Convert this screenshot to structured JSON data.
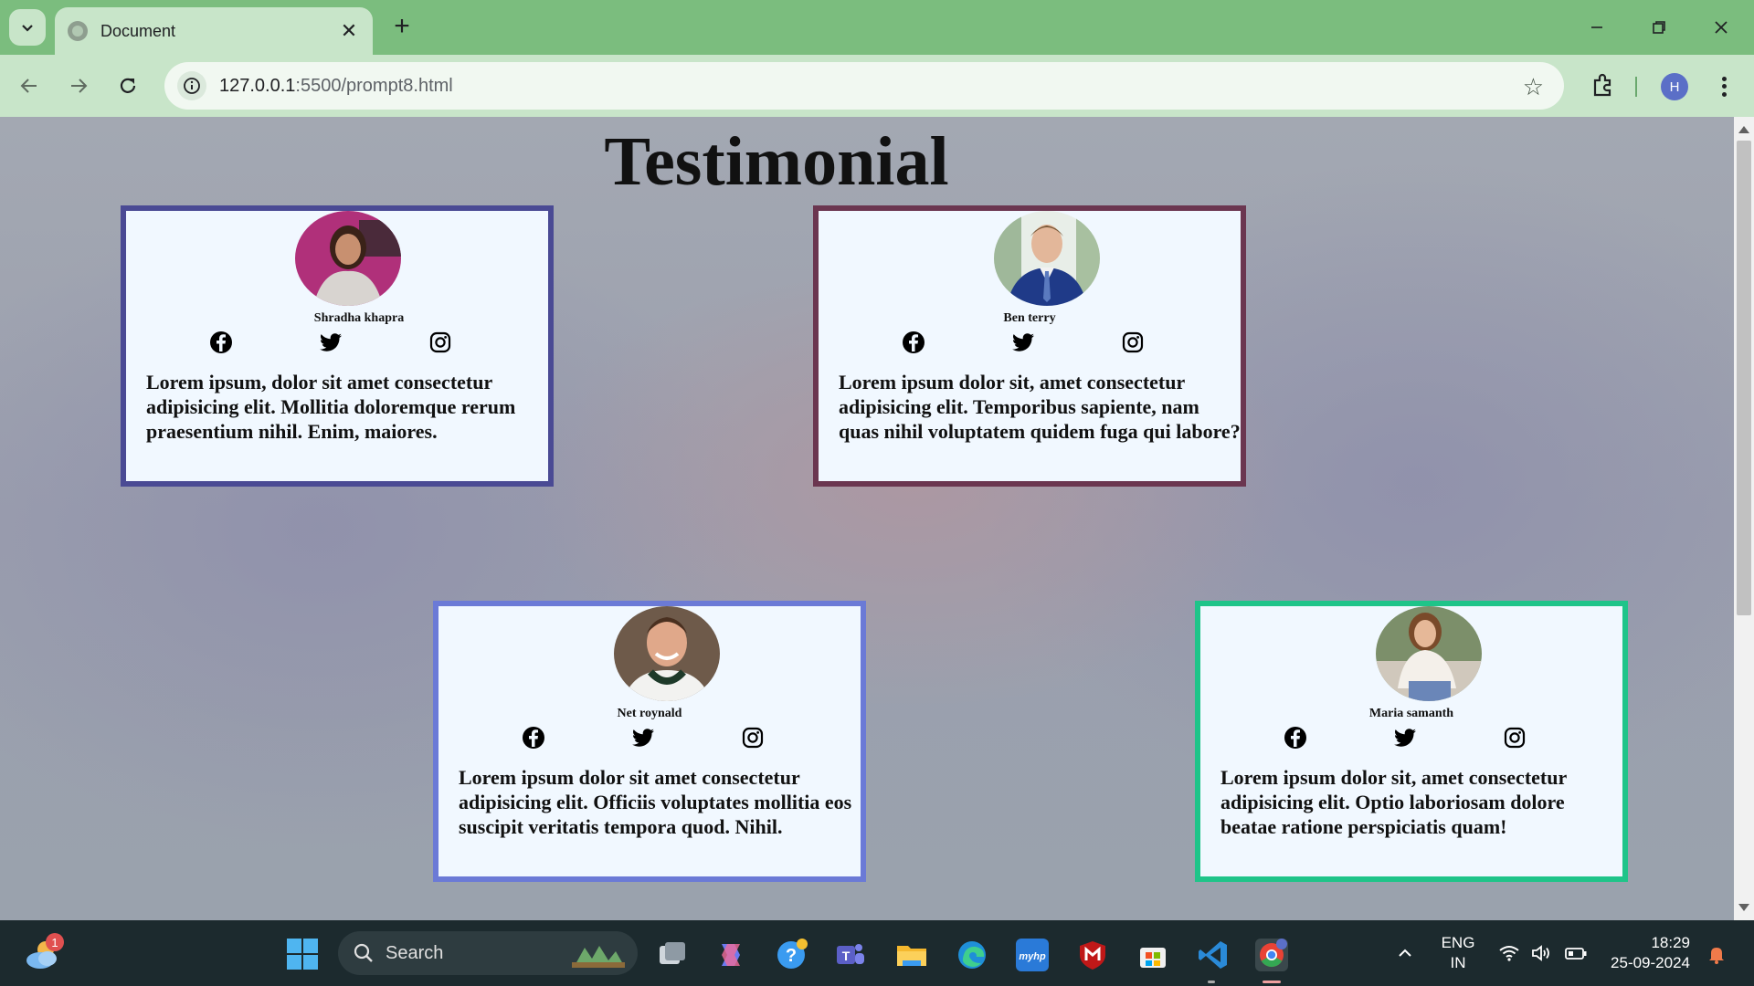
{
  "browser": {
    "tab_title": "Document",
    "url_host": "127.0.0.1",
    "url_path": ":5500/prompt8.html",
    "profile_initial": "H"
  },
  "page": {
    "title": "Testimonial",
    "cards": [
      {
        "name": "Shradha khapra",
        "quote": "Lorem ipsum, dolor sit amet consectetur adipisicing elit. Mollitia doloremque rerum praesentium nihil. Enim, maiores.",
        "border_color": "#4a4a94"
      },
      {
        "name": "Ben terry",
        "quote": "Lorem ipsum dolor sit, amet consectetur adipisicing elit. Temporibus sapiente, nam quas nihil voluptatem quidem fuga qui labore?",
        "border_color": "#6b3650"
      },
      {
        "name": "Net roynald",
        "quote": "Lorem ipsum dolor sit amet consectetur adipisicing elit. Officiis voluptates mollitia eos suscipit veritatis tempora quod. Nihil.",
        "border_color": "#6b7ad6"
      },
      {
        "name": "Maria samanth",
        "quote": "Lorem ipsum dolor sit, amet consectetur adipisicing elit. Optio laboriosam dolore beatae ratione perspiciatis quam!",
        "border_color": "#1fc489"
      }
    ],
    "social_icons": [
      "facebook-icon",
      "twitter-icon",
      "instagram-icon"
    ]
  },
  "taskbar": {
    "weather_badge": "1",
    "search_label": "Search",
    "lang_line1": "ENG",
    "lang_line2": "IN",
    "time": "18:29",
    "date": "25-09-2024"
  }
}
